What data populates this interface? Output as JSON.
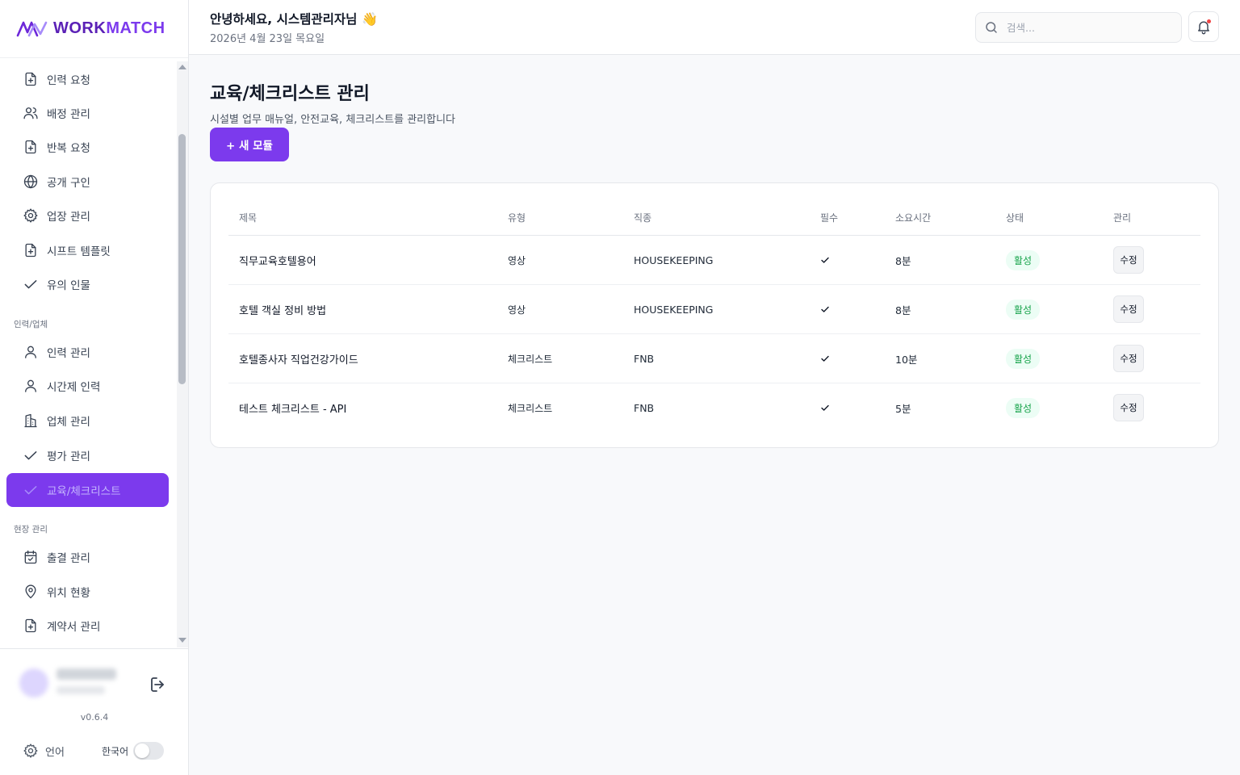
{
  "app": {
    "logo_word1": "WORK",
    "logo_word2": "MATCH"
  },
  "sidebar": {
    "items_top": [
      {
        "label": "인력 요청",
        "icon": "file-plus-icon"
      },
      {
        "label": "배정 관리",
        "icon": "users-icon"
      },
      {
        "label": "반복 요청",
        "icon": "file-plus-icon"
      },
      {
        "label": "공개 구인",
        "icon": "globe-icon"
      },
      {
        "label": "업장 관리",
        "icon": "gear-icon"
      },
      {
        "label": "시프트 템플릿",
        "icon": "file-plus-icon"
      },
      {
        "label": "유의 인물",
        "icon": "check-icon"
      }
    ],
    "section_workforce": "인력/업체",
    "items_workforce": [
      {
        "label": "인력 관리",
        "icon": "user-icon"
      },
      {
        "label": "시간제 인력",
        "icon": "user-icon"
      },
      {
        "label": "업체 관리",
        "icon": "building-icon"
      },
      {
        "label": "평가 관리",
        "icon": "check-icon"
      },
      {
        "label": "교육/체크리스트",
        "icon": "check-icon",
        "active": true
      }
    ],
    "section_field": "현장 관리",
    "items_field": [
      {
        "label": "출결 관리",
        "icon": "calendar-icon"
      },
      {
        "label": "위치 현황",
        "icon": "map-pin-icon"
      },
      {
        "label": "계약서 관리",
        "icon": "file-plus-icon"
      }
    ],
    "version": "v0.6.4",
    "language_label": "언어",
    "language_value": "한국어"
  },
  "header": {
    "greeting": "안녕하세요, 시스템관리자님",
    "greeting_emoji": "👋",
    "date": "2026년 4월 23일 목요일",
    "search_placeholder": "검색..."
  },
  "main": {
    "title": "교육/체크리스트 관리",
    "subtitle": "시설별 업무 매뉴얼, 안전교육, 체크리스트를 관리합니다",
    "new_button": "+ 새 모듈",
    "columns": [
      "제목",
      "유형",
      "직종",
      "필수",
      "소요시간",
      "상태",
      "관리"
    ],
    "rows": [
      {
        "title": "직무교육호텔용어",
        "type": "영상",
        "job": "HOUSEKEEPING",
        "required": true,
        "duration": "8분",
        "status": "활성",
        "action": "수정"
      },
      {
        "title": "호텔 객실 정비 방법",
        "type": "영상",
        "job": "HOUSEKEEPING",
        "required": true,
        "duration": "8분",
        "status": "활성",
        "action": "수정"
      },
      {
        "title": "호텔종사자 직업건강가이드",
        "type": "체크리스트",
        "job": "FNB",
        "required": true,
        "duration": "10분",
        "status": "활성",
        "action": "수정"
      },
      {
        "title": "테스트 체크리스트 - API",
        "type": "체크리스트",
        "job": "FNB",
        "required": true,
        "duration": "5분",
        "status": "활성",
        "action": "수정"
      }
    ]
  },
  "colors": {
    "accent": "#7c3aed",
    "status_active": "#16a34a"
  }
}
